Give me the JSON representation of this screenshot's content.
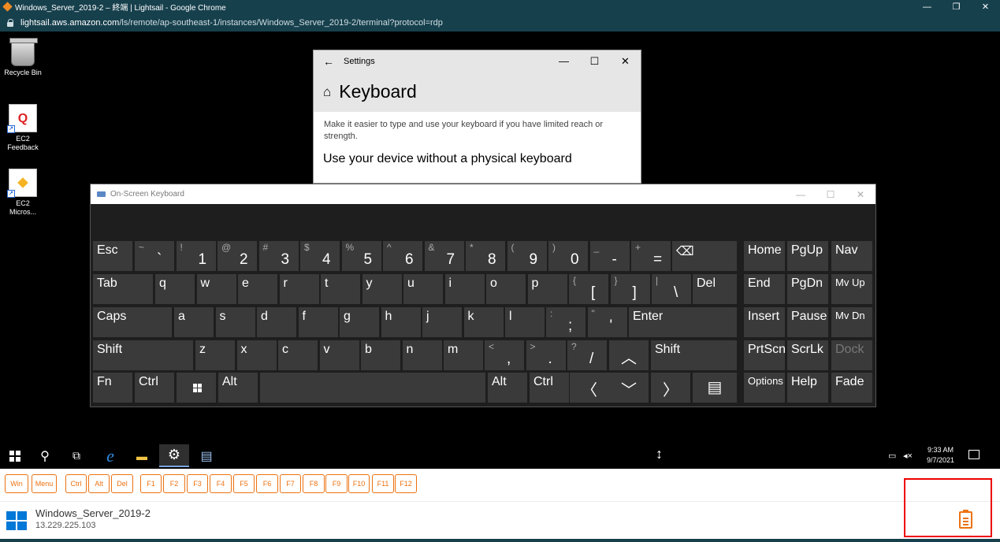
{
  "browser": {
    "title": "Windows_Server_2019-2 – 終端 | Lightsail - Google Chrome",
    "url_host": "lightsail.aws.amazon.com",
    "url_path": "/ls/remote/ap-southeast-1/instances/Windows_Server_2019-2/terminal?protocol=rdp",
    "minimize": "—",
    "restore": "❐",
    "close": "✕"
  },
  "desktop": {
    "icons": [
      {
        "label": "Recycle Bin"
      },
      {
        "label": "EC2 Feedback",
        "glyph": "Q"
      },
      {
        "label": "EC2 Micros...",
        "glyph": ""
      }
    ]
  },
  "settings": {
    "window_title": "Settings",
    "back": "←",
    "minimize": "—",
    "maximize": "☐",
    "close": "✕",
    "home_icon": "⌂",
    "heading": "Keyboard",
    "description": "Make it easier to type and use your keyboard if you have limited reach or strength.",
    "section": "Use your device without a physical keyboard"
  },
  "osk": {
    "window_title": "On-Screen Keyboard",
    "minimize": "—",
    "maximize": "☐",
    "close": "✕",
    "keys": {
      "esc": "Esc",
      "tab": "Tab",
      "caps": "Caps",
      "shift": "Shift",
      "fn": "Fn",
      "ctrl": "Ctrl",
      "alt": "Alt",
      "alt_r": "Alt",
      "ctrl_r": "Ctrl",
      "shift_r": "Shift",
      "del": "Del",
      "enter": "Enter",
      "home": "Home",
      "pgup": "PgUp",
      "nav": "Nav",
      "end": "End",
      "pgdn": "PgDn",
      "mvup": "Mv Up",
      "insert": "Insert",
      "pause": "Pause",
      "mvdn": "Mv Dn",
      "prtscn": "PrtScn",
      "scrlk": "ScrLk",
      "dock": "Dock",
      "options": "Options",
      "help": "Help",
      "fade": "Fade",
      "backspace": "⌫",
      "num_top": [
        "~",
        "!",
        "@",
        "#",
        "$",
        "%",
        "^",
        "&",
        "*",
        "(",
        ")",
        "_",
        "+"
      ],
      "num_bot": [
        "`",
        "1",
        "2",
        "3",
        "4",
        "5",
        "6",
        "7",
        "8",
        "9",
        "0",
        "-",
        "="
      ],
      "row_q": [
        "q",
        "w",
        "e",
        "r",
        "t",
        "y",
        "u",
        "i",
        "o",
        "p"
      ],
      "bracket_top": [
        "{",
        "}",
        "|"
      ],
      "bracket_bot": [
        "[",
        "]",
        "\\"
      ],
      "row_a": [
        "a",
        "s",
        "d",
        "f",
        "g",
        "h",
        "j",
        "k",
        "l"
      ],
      "semi_top": [
        ":",
        "\""
      ],
      "semi_bot": [
        ";",
        "'"
      ],
      "row_z": [
        "z",
        "x",
        "c",
        "v",
        "b",
        "n",
        "m"
      ],
      "comma_top": [
        "<",
        ">",
        "?"
      ],
      "comma_bot": [
        ",",
        ".",
        "/"
      ],
      "arrow_up": "︿",
      "arrow_left": "〈",
      "arrow_down": "﹀",
      "arrow_right": "〉",
      "menu_key": "▤"
    }
  },
  "taskbar": {
    "time": "9:33 AM",
    "date": "9/7/2021",
    "search_icon": "⚲",
    "taskview_icon": "⧉",
    "ie_icon": "e",
    "explorer_icon": "▬",
    "settings_icon": "⚙",
    "server_icon": "▤",
    "network_icon": "▭",
    "volume_icon": "◂×"
  },
  "lightsail": {
    "keys": [
      "Win",
      "Menu",
      "Ctrl",
      "Alt",
      "Del",
      "F1",
      "F2",
      "F3",
      "F4",
      "F5",
      "F6",
      "F7",
      "F8",
      "F9",
      "F10",
      "F11",
      "F12"
    ],
    "instance_name": "Windows_Server_2019-2",
    "instance_ip": "13.229.225.103",
    "resize_icon": "↕",
    "accent": "#ec7211"
  }
}
